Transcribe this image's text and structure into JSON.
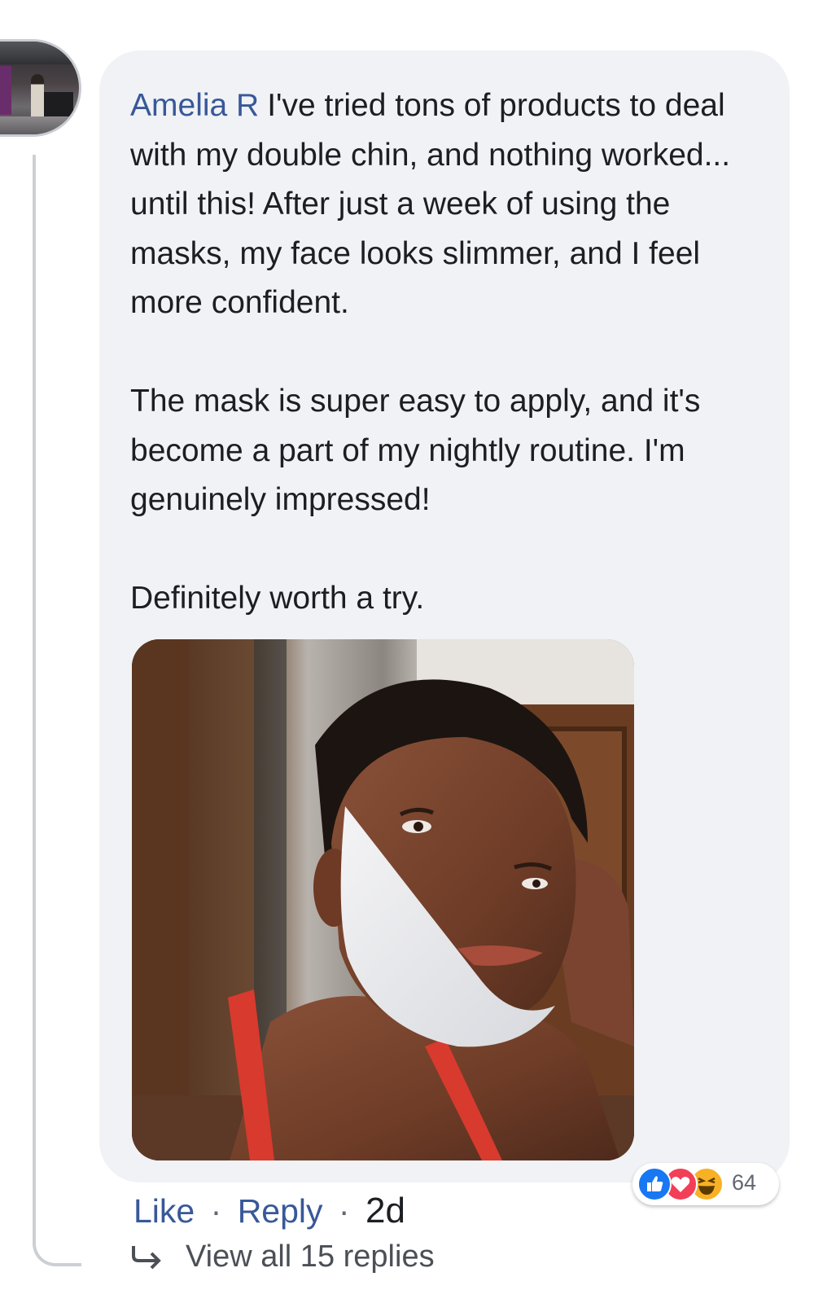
{
  "comment": {
    "author": "Amelia R",
    "paragraphs": [
      "I've tried tons of products to deal with my double chin, and nothing worked... until this! After just a week of using the masks, my face looks slimmer, and I feel more confident.",
      "The mask is super easy to apply, and it's become a part of my nightly routine. I'm genuinely impressed!",
      "Definitely worth a try."
    ]
  },
  "reactions": {
    "icons": [
      "like-icon",
      "love-icon",
      "haha-icon"
    ],
    "count": "64",
    "colors": {
      "like": "#1877f2",
      "love": "#f33e58",
      "haha": "#f7b125"
    }
  },
  "actions": {
    "like_label": "Like",
    "separator": "·",
    "reply_label": "Reply",
    "time": "2d"
  },
  "replies": {
    "label": "View all 15 replies",
    "icon": "reply-arrow-icon"
  },
  "colors": {
    "link": "#385898",
    "bubble": "#f0f2f5",
    "text": "#1c1e21",
    "meta": "#606770"
  }
}
